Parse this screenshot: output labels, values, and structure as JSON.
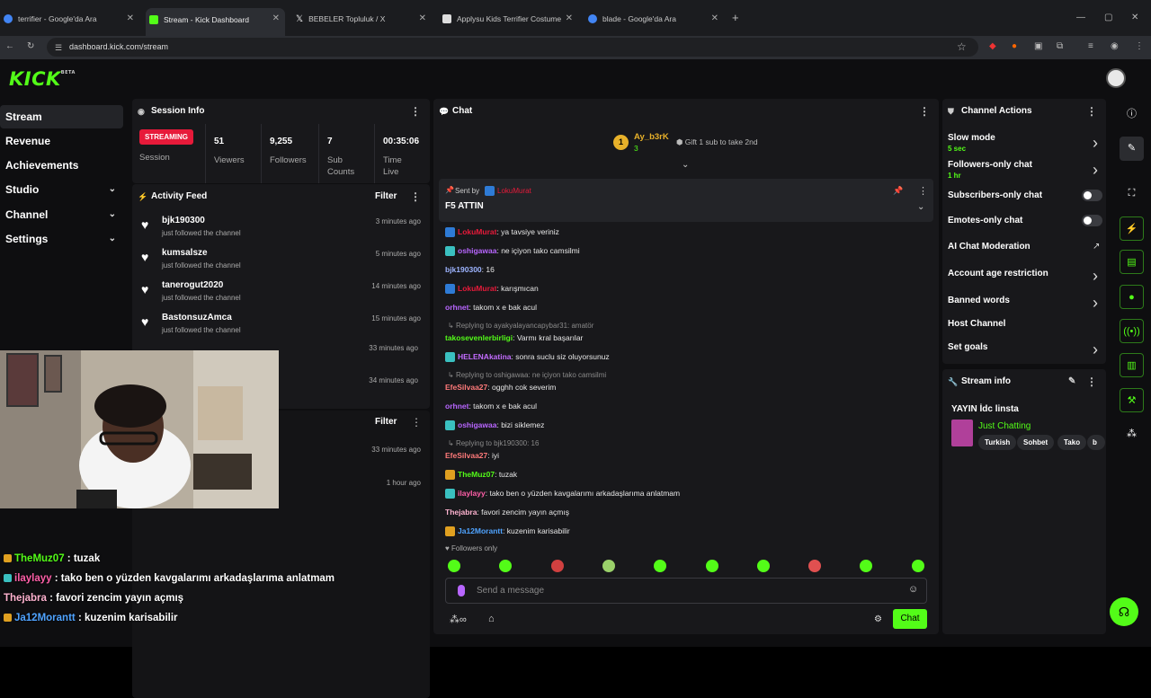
{
  "browser": {
    "tabs": [
      {
        "title": "terrifier - Google'da Ara",
        "color": "#4285f4"
      },
      {
        "title": "Stream - Kick Dashboard",
        "color": "#53fc18"
      },
      {
        "title": "BEBELER Topluluk / X",
        "color": "#ffffff"
      },
      {
        "title": "Applysu Kids Terrifier Costume",
        "color": "#dddddd"
      },
      {
        "title": "blade - Google'da Ara",
        "color": "#4285f4"
      }
    ],
    "url": "dashboard.kick.com/stream"
  },
  "header": {
    "logo": "KICK",
    "logo_sup": "BETA"
  },
  "nav": [
    {
      "label": "Stream",
      "active": true,
      "chevron": false
    },
    {
      "label": "Revenue",
      "chevron": false
    },
    {
      "label": "Achievements",
      "chevron": false
    },
    {
      "label": "Studio",
      "chevron": true
    },
    {
      "label": "Channel",
      "chevron": true
    },
    {
      "label": "Settings",
      "chevron": true
    }
  ],
  "session": {
    "title": "Session Info",
    "status": "STREAMING",
    "status_label": "Session",
    "stats": [
      {
        "value": "51",
        "label": "Viewers"
      },
      {
        "value": "9,255",
        "label": "Followers"
      },
      {
        "value": "7",
        "label": "Sub Counts"
      },
      {
        "value": "00:35:06",
        "label": "Time Live"
      }
    ]
  },
  "activity": {
    "title": "Activity Feed",
    "filter": "Filter",
    "items": [
      {
        "user": "bjk190300",
        "action": "just followed the channel",
        "time": "3 minutes ago"
      },
      {
        "user": "kumsalsze",
        "action": "just followed the channel",
        "time": "5 minutes ago"
      },
      {
        "user": "tanerogut2020",
        "action": "just followed the channel",
        "time": "14 minutes ago"
      },
      {
        "user": "BastonsuzAmca",
        "action": "just followed the channel",
        "time": "15 minutes ago"
      }
    ],
    "hidden_times": [
      "33 minutes ago",
      "34 minutes ago"
    ],
    "second_filter": "Filter",
    "second_times": [
      "33 minutes ago",
      "1 hour ago"
    ]
  },
  "chat": {
    "title": "Chat",
    "gifter": {
      "name": "Ay_b3rK",
      "count": "3",
      "text": "Gift 1 sub to take 2nd"
    },
    "pinned": {
      "sent_by": "Sent by",
      "user": "LokuMurat",
      "text": "F5 ATTIN"
    },
    "messages": [
      {
        "type": "msg",
        "user": "LokuMurat",
        "color": "#e71a3a",
        "text": ": ya tavsiye veriniz",
        "badge": "#2e7bd6"
      },
      {
        "type": "msg",
        "user": "oshigawaa",
        "color": "#b866ff",
        "text": ": ne içiyon tako camsilmi",
        "badge": "#3ac0c0"
      },
      {
        "type": "msg",
        "user": "bjk190300",
        "color": "#9db4ff",
        "text": ": 16"
      },
      {
        "type": "msg",
        "user": "LokuMurat",
        "color": "#e71a3a",
        "text": ": karışmıcan",
        "badge": "#2e7bd6"
      },
      {
        "type": "msg",
        "user": "orhnet",
        "color": "#b866ff",
        "text": ": takom x e bak acul"
      },
      {
        "type": "reply",
        "text": "Replying to ayakyalayancapybar31: amatör"
      },
      {
        "type": "msg",
        "user": "takosevenlerbirligi",
        "color": "#53fc18",
        "text": ": Varmı kral başarılar"
      },
      {
        "type": "msg",
        "user": "HELENAkatina",
        "color": "#c36cff",
        "text": ": sonra suclu siz oluyorsunuz",
        "badge": "#3ac0c0"
      },
      {
        "type": "reply",
        "text": "Replying to oshigawaa: ne içiyon tako camsilmi"
      },
      {
        "type": "msg",
        "user": "EfeSilvaa27",
        "color": "#ff7a7a",
        "text": ": ogghh cok severim"
      },
      {
        "type": "msg",
        "user": "orhnet",
        "color": "#b866ff",
        "text": ": takom x e bak acul"
      },
      {
        "type": "msg",
        "user": "oshigawaa",
        "color": "#b866ff",
        "text": ": bizi siklemez",
        "badge": "#3ac0c0"
      },
      {
        "type": "reply",
        "text": "Replying to bjk190300: 16"
      },
      {
        "type": "msg",
        "user": "EfeSilvaa27",
        "color": "#ff7a7a",
        "text": ": iyi"
      },
      {
        "type": "msg",
        "user": "TheMuz07",
        "color": "#53fc18",
        "text": ": tuzak",
        "badge": "#e0a020"
      },
      {
        "type": "msg",
        "user": "ilaylayy",
        "color": "#ff5fa8",
        "text": ": tako ben o yüzden kavgalarımı arkadaşlarıma anlatmam",
        "badge": "#3ac0c0"
      },
      {
        "type": "msg",
        "user": "Thejabra",
        "color": "#ffb3d0",
        "text": ": favori zencim yayın açmış"
      },
      {
        "type": "msg",
        "user": "Ja12Morantt",
        "color": "#4fa3ff",
        "text": ": kuzenim karisabilir",
        "badge": "#e0a020"
      }
    ],
    "followers_only": "Followers only",
    "placeholder": "Send a message",
    "send": "Chat"
  },
  "channel_actions": {
    "title": "Channel Actions",
    "items": [
      {
        "label": "Slow mode",
        "sub": "5 sec",
        "control": "arrow"
      },
      {
        "label": "Followers-only chat",
        "sub": "1 hr",
        "control": "arrow"
      },
      {
        "label": "Subscribers-only chat",
        "control": "toggle"
      },
      {
        "label": "Emotes-only chat",
        "control": "toggle"
      },
      {
        "label": "AI Chat Moderation",
        "control": "external"
      },
      {
        "label": "Account age restriction",
        "control": "arrow"
      },
      {
        "label": "Banned words",
        "control": "arrow"
      },
      {
        "label": "Host Channel",
        "control": "none"
      },
      {
        "label": "Set goals",
        "control": "arrow"
      }
    ]
  },
  "stream_info": {
    "title": "Stream info",
    "stream_title": "YAYIN İdc linsta",
    "category": "Just Chatting",
    "tags": [
      "Turkish",
      "Sohbet",
      "Tako",
      "b"
    ]
  },
  "overlay_chat": [
    {
      "user": "TheMuz07",
      "text": " : tuzak",
      "color": "#53fc18"
    },
    {
      "user": "ilaylayy",
      "text": " : tako ben o yüzden kavgalarımı arkadaşlarıma anlatmam",
      "color": "#ff5fa8"
    },
    {
      "user": "Thejabra",
      "text": " : favori zencim yayın açmış",
      "color": "#ffb3d0"
    },
    {
      "user": "Ja12Morantt",
      "text": " : kuzenim karisabilir",
      "color": "#4fa3ff"
    }
  ]
}
